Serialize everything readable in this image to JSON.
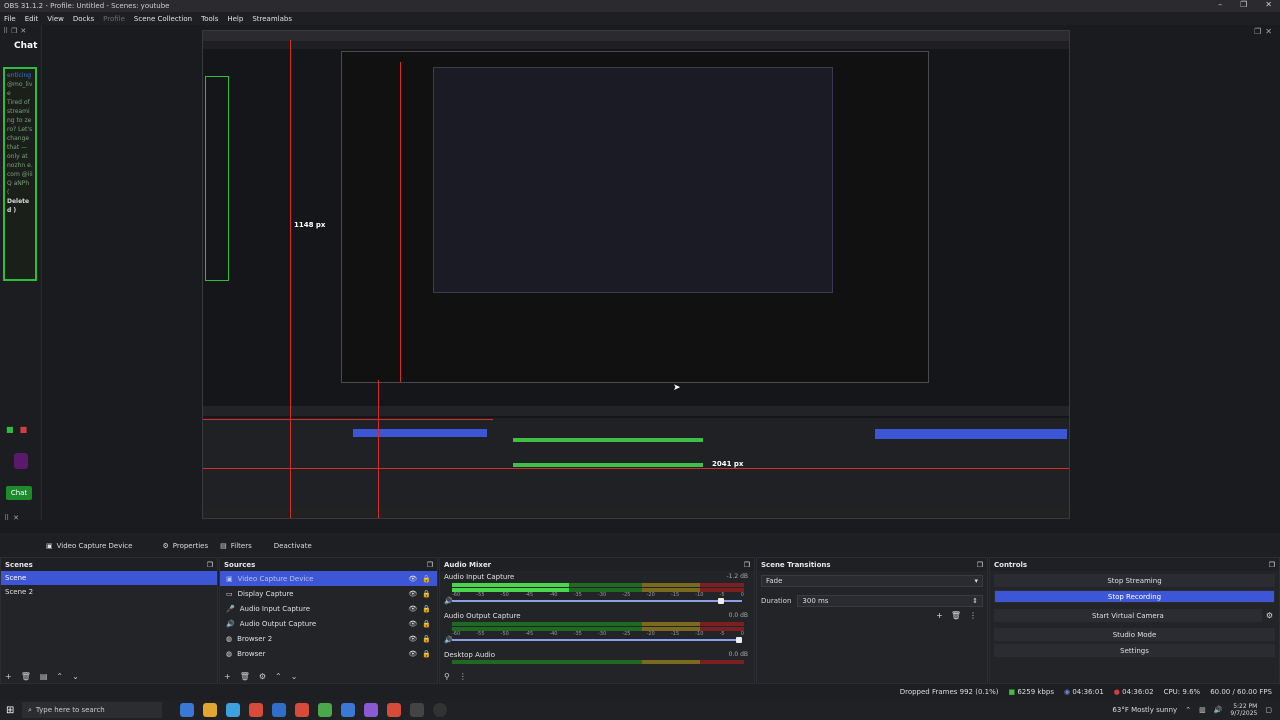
{
  "window": {
    "title": "OBS 31.1.2 - Profile: Untitled - Scenes: youtube",
    "controls": [
      "–",
      "❐",
      "✕"
    ]
  },
  "menu": {
    "file": "File",
    "edit": "Edit",
    "view": "View",
    "docks": "Docks",
    "profile": "Profile",
    "scene_collection": "Scene Collection",
    "tools": "Tools",
    "help": "Help",
    "streamlabs": "Streamlabs"
  },
  "chat_dock": {
    "title": "Chat",
    "messages": [
      "enticing",
      "@mo_live",
      "Tired of streaming to zero? Let's change that —",
      "only at nozhn e.com @iiiQ aNPh (",
      "Deleted )"
    ],
    "chat_button": "Chat"
  },
  "preview": {
    "height_label": "1148 px",
    "width_label": "2041 px"
  },
  "source_toolbar": {
    "source_name": "Video Capture Device",
    "properties": "Properties",
    "filters": "Filters",
    "deactivate": "Deactivate"
  },
  "scenes": {
    "title": "Scenes",
    "items": [
      "Scene",
      "Scene 2"
    ]
  },
  "sources": {
    "title": "Sources",
    "items": [
      "Video Capture Device",
      "Display Capture",
      "Audio Input Capture",
      "Audio Output Capture",
      "Browser 2",
      "Browser"
    ]
  },
  "audio_mixer": {
    "title": "Audio Mixer",
    "channels": [
      {
        "name": "Audio Input Capture",
        "db": "-1.2 dB"
      },
      {
        "name": "Audio Output Capture",
        "db": "0.0 dB"
      },
      {
        "name": "Desktop Audio",
        "db": "0.0 dB"
      }
    ],
    "ticks": [
      "-60",
      "-55",
      "-50",
      "-45",
      "-40",
      "-35",
      "-30",
      "-25",
      "-20",
      "-15",
      "-10",
      "-5",
      "0"
    ]
  },
  "scene_transitions": {
    "title": "Scene Transitions",
    "transition": "Fade",
    "duration_label": "Duration",
    "duration_value": "300 ms"
  },
  "controls": {
    "title": "Controls",
    "stop_streaming": "Stop Streaming",
    "stop_recording": "Stop Recording",
    "start_virtual_camera": "Start Virtual Camera",
    "studio_mode": "Studio Mode",
    "settings": "Settings"
  },
  "status": {
    "dropped_frames": "Dropped Frames 992 (0.1%)",
    "bitrate": "6259 kbps",
    "stream_time": "04:36:01",
    "rec_time": "04:36:02",
    "cpu": "CPU: 9.6%",
    "fps": "60.00 / 60.00 FPS"
  },
  "taskbar": {
    "search_placeholder": "Type here to search",
    "weather": "63°F  Mostly sunny",
    "time": "5:22 PM",
    "date": "9/7/2025"
  }
}
